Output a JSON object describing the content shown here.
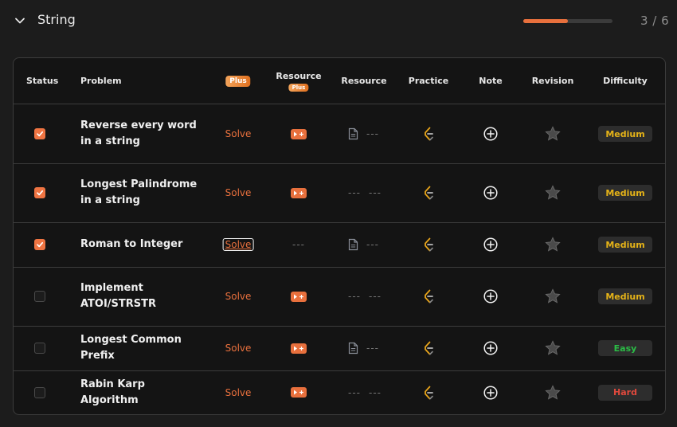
{
  "section": {
    "title": "String",
    "progress_text": "3 / 6",
    "progress_fraction": 0.5
  },
  "table": {
    "headers": {
      "status": "Status",
      "problem": "Problem",
      "plus": "Plus",
      "resource_plus": "Resource",
      "resource_plus_badge": "Plus",
      "resource": "Resource",
      "practice": "Practice",
      "note": "Note",
      "revision": "Revision",
      "difficulty": "Difficulty"
    },
    "dash": "---",
    "rows": [
      {
        "done": true,
        "title": "Reverse every word in a string",
        "solve": "Solve",
        "resource_plus": "video",
        "resource_doc": true,
        "difficulty": "Medium"
      },
      {
        "done": true,
        "title": "Longest Palindrome in a string",
        "solve": "Solve",
        "resource_plus": "video",
        "resource_doc": false,
        "difficulty": "Medium"
      },
      {
        "done": true,
        "title": "Roman to Integer",
        "solve": "Solve",
        "resource_plus": "none",
        "resource_doc": true,
        "difficulty": "Medium"
      },
      {
        "done": false,
        "title": "Implement ATOI/STRSTR",
        "solve": "Solve",
        "resource_plus": "video",
        "resource_doc": false,
        "difficulty": "Medium"
      },
      {
        "done": false,
        "title": "Longest Common Prefix",
        "solve": "Solve",
        "resource_plus": "video",
        "resource_doc": true,
        "difficulty": "Easy"
      },
      {
        "done": false,
        "title": "Rabin Karp Algorithm",
        "solve": "Solve",
        "resource_plus": "video",
        "resource_doc": false,
        "difficulty": "Hard"
      }
    ]
  },
  "colors": {
    "accent": "#e8703d",
    "medium": "#e5b318",
    "easy": "#2bbd46",
    "hard": "#e0493d"
  },
  "icons": {
    "toggle": "chevron-down-icon",
    "check": "check-icon",
    "video": "video-play-icon",
    "doc": "document-icon",
    "practice": "practice-brand-icon",
    "note": "add-note-icon",
    "revision": "star-icon"
  }
}
